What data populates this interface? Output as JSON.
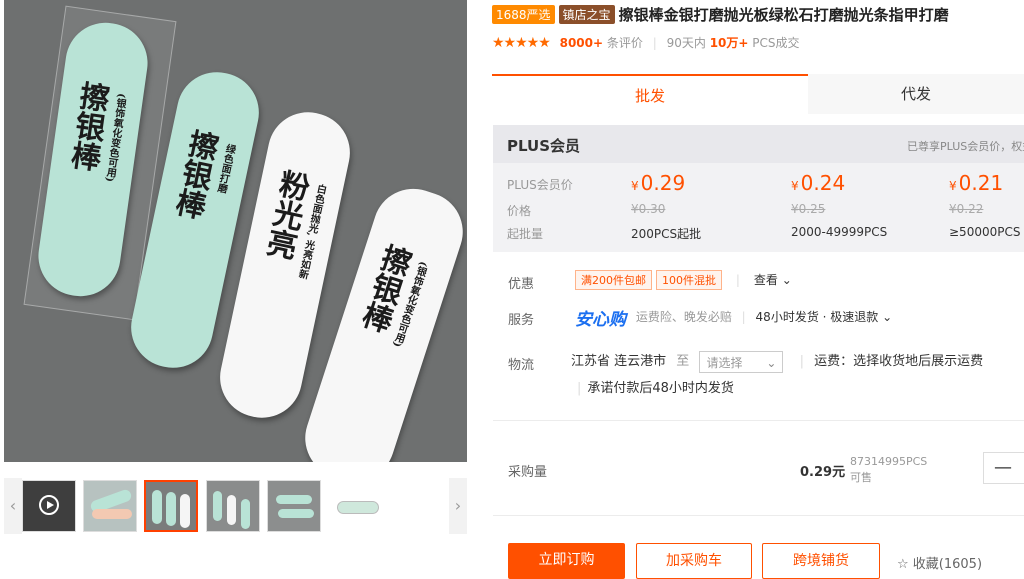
{
  "product": {
    "tag_1688": "1688严选",
    "tag_shop": "镇店之宝",
    "title": "擦银棒金银打磨抛光板绿松石打磨抛光条指甲打磨",
    "stars": "★★★★★",
    "review_count": "8000+",
    "review_label": "条评价",
    "sales_label": "90天内",
    "sales_count": "10万+",
    "sales_unit": "PCS成交",
    "image_text": {
      "stick_big": "擦银棒",
      "stick_small_1": "(银饰氧化变色可用)",
      "stick_small_2": "绿色面打磨",
      "stick_white_big": "粉光亮",
      "stick_white_small": "白色面抛光, 光亮如新"
    }
  },
  "tabs": [
    {
      "label": "批发"
    },
    {
      "label": "代发"
    }
  ],
  "plus": {
    "title": "PLUS会员",
    "note": "已尊享PLUS会员价，权益",
    "labels": {
      "member_price": "PLUS会员价",
      "price": "价格",
      "min_qty": "起批量"
    },
    "currency": "¥",
    "tiers": [
      {
        "member_price": "0.29",
        "price": "¥0.30",
        "qty": "200PCS起批"
      },
      {
        "member_price": "0.24",
        "price": "¥0.25",
        "qty": "2000-49999PCS"
      },
      {
        "member_price": "0.21",
        "price": "¥0.22",
        "qty": "≥50000PCS"
      }
    ]
  },
  "promo": {
    "label": "优惠",
    "chips": [
      "满200件包邮",
      "100件混批"
    ],
    "view_more": "查看 ⌄"
  },
  "service": {
    "label": "服务",
    "brand": "安心购",
    "items": "运费险、晚发必赔",
    "shipping": "48小时发货 · 极速退款 ⌄"
  },
  "logistics": {
    "label": "物流",
    "from": "江苏省 连云港市",
    "to": "至",
    "select_placeholder": "请选择",
    "fee_text": "运费：选择收货地后展示运费",
    "promise": "承诺付款后48小时内发货"
  },
  "purchase": {
    "label": "采购量",
    "unit_price": "0.29元",
    "stock_count": "87314995PCS",
    "stock_label": "可售",
    "stepper_minus": "—"
  },
  "actions": {
    "buy": "立即订购",
    "cart": "加采购车",
    "cross": "跨境铺货",
    "favorite": "☆ 收藏(1605)"
  },
  "colors": {
    "accent": "#ff5000",
    "brand_blue": "#1b6ff0"
  }
}
